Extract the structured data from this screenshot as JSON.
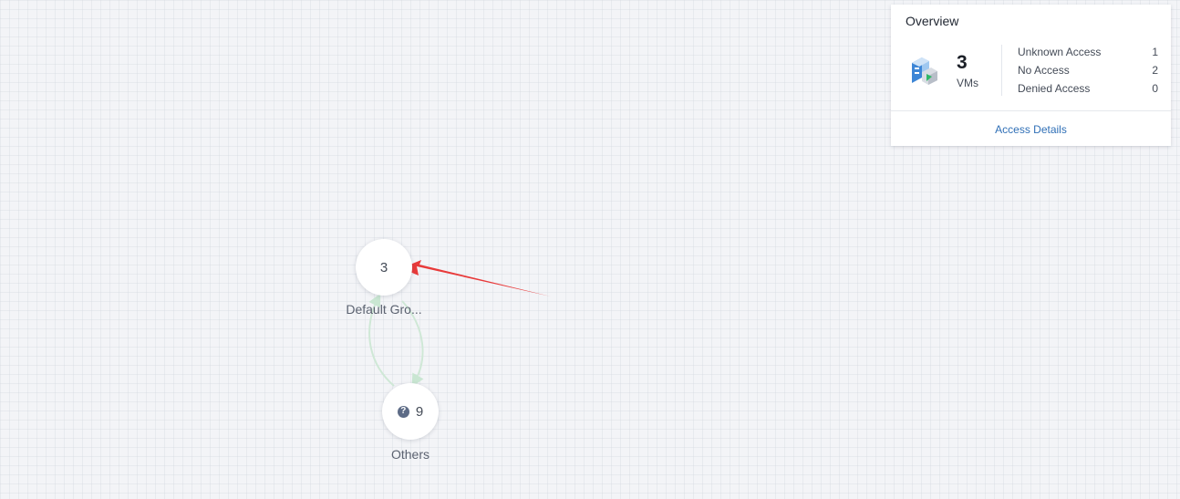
{
  "graph": {
    "nodes": [
      {
        "id": "default-group",
        "count": "3",
        "label": "Default Gro..."
      },
      {
        "id": "others",
        "count": "9",
        "label": "Others",
        "icon": "question-icon"
      }
    ],
    "edge_color": "#cfe8d6",
    "annotation_arrow_color": "#e83a3a"
  },
  "overview": {
    "title": "Overview",
    "icon": "vm-server-icon",
    "vm_count": "3",
    "vm_unit": "VMs",
    "rows": [
      {
        "label": "Unknown Access",
        "value": "1"
      },
      {
        "label": "No Access",
        "value": "2"
      },
      {
        "label": "Denied Access",
        "value": "0"
      }
    ],
    "link_label": "Access Details",
    "link_color": "#2f6fb6"
  }
}
